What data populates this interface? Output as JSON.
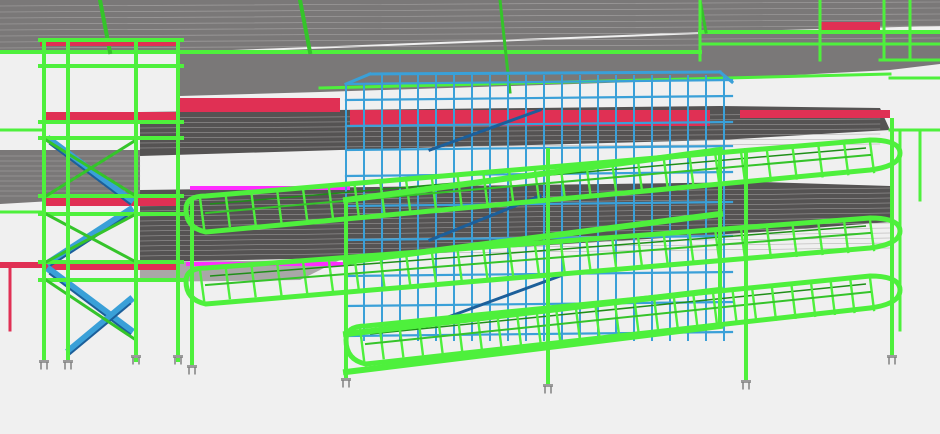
{
  "viewport": {
    "background": "#f0f0f0"
  },
  "colors": {
    "steel_green": "#4ef03c",
    "steel_green_dark": "#1f8f18",
    "steel_green_mid": "#35c42a",
    "railing_blue": "#3aa0d8",
    "railing_blue_dark": "#1c5f9a",
    "beam_red": "#e03054",
    "accent_magenta": "#ff2cff",
    "slab_gray": "#7a7878",
    "slab_gray_dark": "#555353",
    "slab_gray_light": "#a9a7a7",
    "footing": "#9a9a9a",
    "footing_dark": "#4a4a4a"
  },
  "scene": {
    "model_kind": "3D structural steel model",
    "components": [
      "stair-tower",
      "curved-ramp-levels",
      "blue-railing-cage",
      "roof-slabs",
      "column-footings"
    ]
  }
}
